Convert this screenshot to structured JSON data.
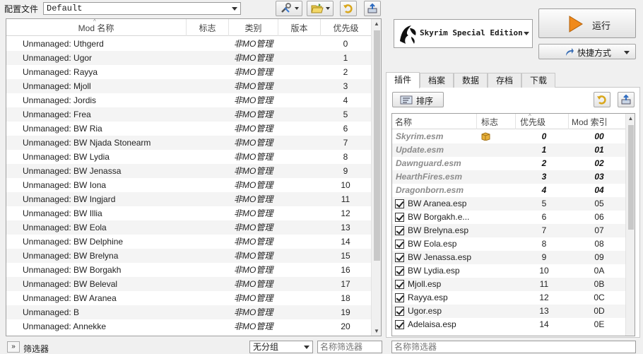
{
  "profile": {
    "label": "配置文件",
    "selected": "Default"
  },
  "mod_list": {
    "columns": [
      "Mod 名称",
      "标志",
      "类别",
      "版本",
      "优先级"
    ],
    "rows": [
      {
        "name": "Unmanaged: Uthgerd",
        "category": "非MO管理",
        "priority": "0"
      },
      {
        "name": "Unmanaged: Ugor",
        "category": "非MO管理",
        "priority": "1"
      },
      {
        "name": "Unmanaged: Rayya",
        "category": "非MO管理",
        "priority": "2"
      },
      {
        "name": "Unmanaged: Mjoll",
        "category": "非MO管理",
        "priority": "3"
      },
      {
        "name": "Unmanaged: Jordis",
        "category": "非MO管理",
        "priority": "4"
      },
      {
        "name": "Unmanaged: Frea",
        "category": "非MO管理",
        "priority": "5"
      },
      {
        "name": "Unmanaged: BW Ria",
        "category": "非MO管理",
        "priority": "6"
      },
      {
        "name": "Unmanaged: BW Njada Stonearm",
        "category": "非MO管理",
        "priority": "7"
      },
      {
        "name": "Unmanaged: BW Lydia",
        "category": "非MO管理",
        "priority": "8"
      },
      {
        "name": "Unmanaged: BW Jenassa",
        "category": "非MO管理",
        "priority": "9"
      },
      {
        "name": "Unmanaged: BW Iona",
        "category": "非MO管理",
        "priority": "10"
      },
      {
        "name": "Unmanaged: BW Ingjard",
        "category": "非MO管理",
        "priority": "11"
      },
      {
        "name": "Unmanaged: BW Illia",
        "category": "非MO管理",
        "priority": "12"
      },
      {
        "name": "Unmanaged: BW Eola",
        "category": "非MO管理",
        "priority": "13"
      },
      {
        "name": "Unmanaged: BW Delphine",
        "category": "非MO管理",
        "priority": "14"
      },
      {
        "name": "Unmanaged: BW Brelyna",
        "category": "非MO管理",
        "priority": "15"
      },
      {
        "name": "Unmanaged: BW Borgakh",
        "category": "非MO管理",
        "priority": "16"
      },
      {
        "name": "Unmanaged: BW Beleval",
        "category": "非MO管理",
        "priority": "17"
      },
      {
        "name": "Unmanaged: BW Aranea",
        "category": "非MO管理",
        "priority": "18"
      },
      {
        "name": "Unmanaged: B",
        "category": "非MO管理",
        "priority": "19"
      },
      {
        "name": "Unmanaged: Annekke",
        "category": "非MO管理",
        "priority": "20"
      }
    ]
  },
  "filter_bar": {
    "expand": "»",
    "filter_label": "筛选器",
    "group_select": "无分组",
    "name_filter_placeholder": "名称筛选器"
  },
  "executable": {
    "name": "Skyrim Special Edition"
  },
  "run_button": {
    "label": "运行"
  },
  "shortcut_button": {
    "label": "快捷方式"
  },
  "tabs": [
    "插件",
    "档案",
    "数据",
    "存档",
    "下载"
  ],
  "sort_button": {
    "label": "排序"
  },
  "plugin_list": {
    "columns": [
      "名称",
      "标志",
      "优先级",
      "Mod 索引"
    ],
    "rows": [
      {
        "name": "Skyrim.esm",
        "priority": "0",
        "index": "00",
        "master": true
      },
      {
        "name": "Update.esm",
        "priority": "1",
        "index": "01",
        "master": true
      },
      {
        "name": "Dawnguard.esm",
        "priority": "2",
        "index": "02",
        "master": true
      },
      {
        "name": "HearthFires.esm",
        "priority": "3",
        "index": "03",
        "master": true
      },
      {
        "name": "Dragonborn.esm",
        "priority": "4",
        "index": "04",
        "master": true
      },
      {
        "name": "BW Aranea.esp",
        "priority": "5",
        "index": "05",
        "master": false
      },
      {
        "name": "BW Borgakh.e...",
        "priority": "6",
        "index": "06",
        "master": false
      },
      {
        "name": "BW Brelyna.esp",
        "priority": "7",
        "index": "07",
        "master": false
      },
      {
        "name": "BW Eola.esp",
        "priority": "8",
        "index": "08",
        "master": false
      },
      {
        "name": "BW Jenassa.esp",
        "priority": "9",
        "index": "09",
        "master": false
      },
      {
        "name": "BW Lydia.esp",
        "priority": "10",
        "index": "0A",
        "master": false
      },
      {
        "name": "Mjoll.esp",
        "priority": "11",
        "index": "0B",
        "master": false
      },
      {
        "name": "Rayya.esp",
        "priority": "12",
        "index": "0C",
        "master": false
      },
      {
        "name": "Ugor.esp",
        "priority": "13",
        "index": "0D",
        "master": false
      },
      {
        "name": "Adelaisa.esp",
        "priority": "14",
        "index": "0E",
        "master": false
      }
    ]
  },
  "colors": {
    "run_icon": "#f08a1c",
    "accent_yellow": "#e8c23a"
  }
}
